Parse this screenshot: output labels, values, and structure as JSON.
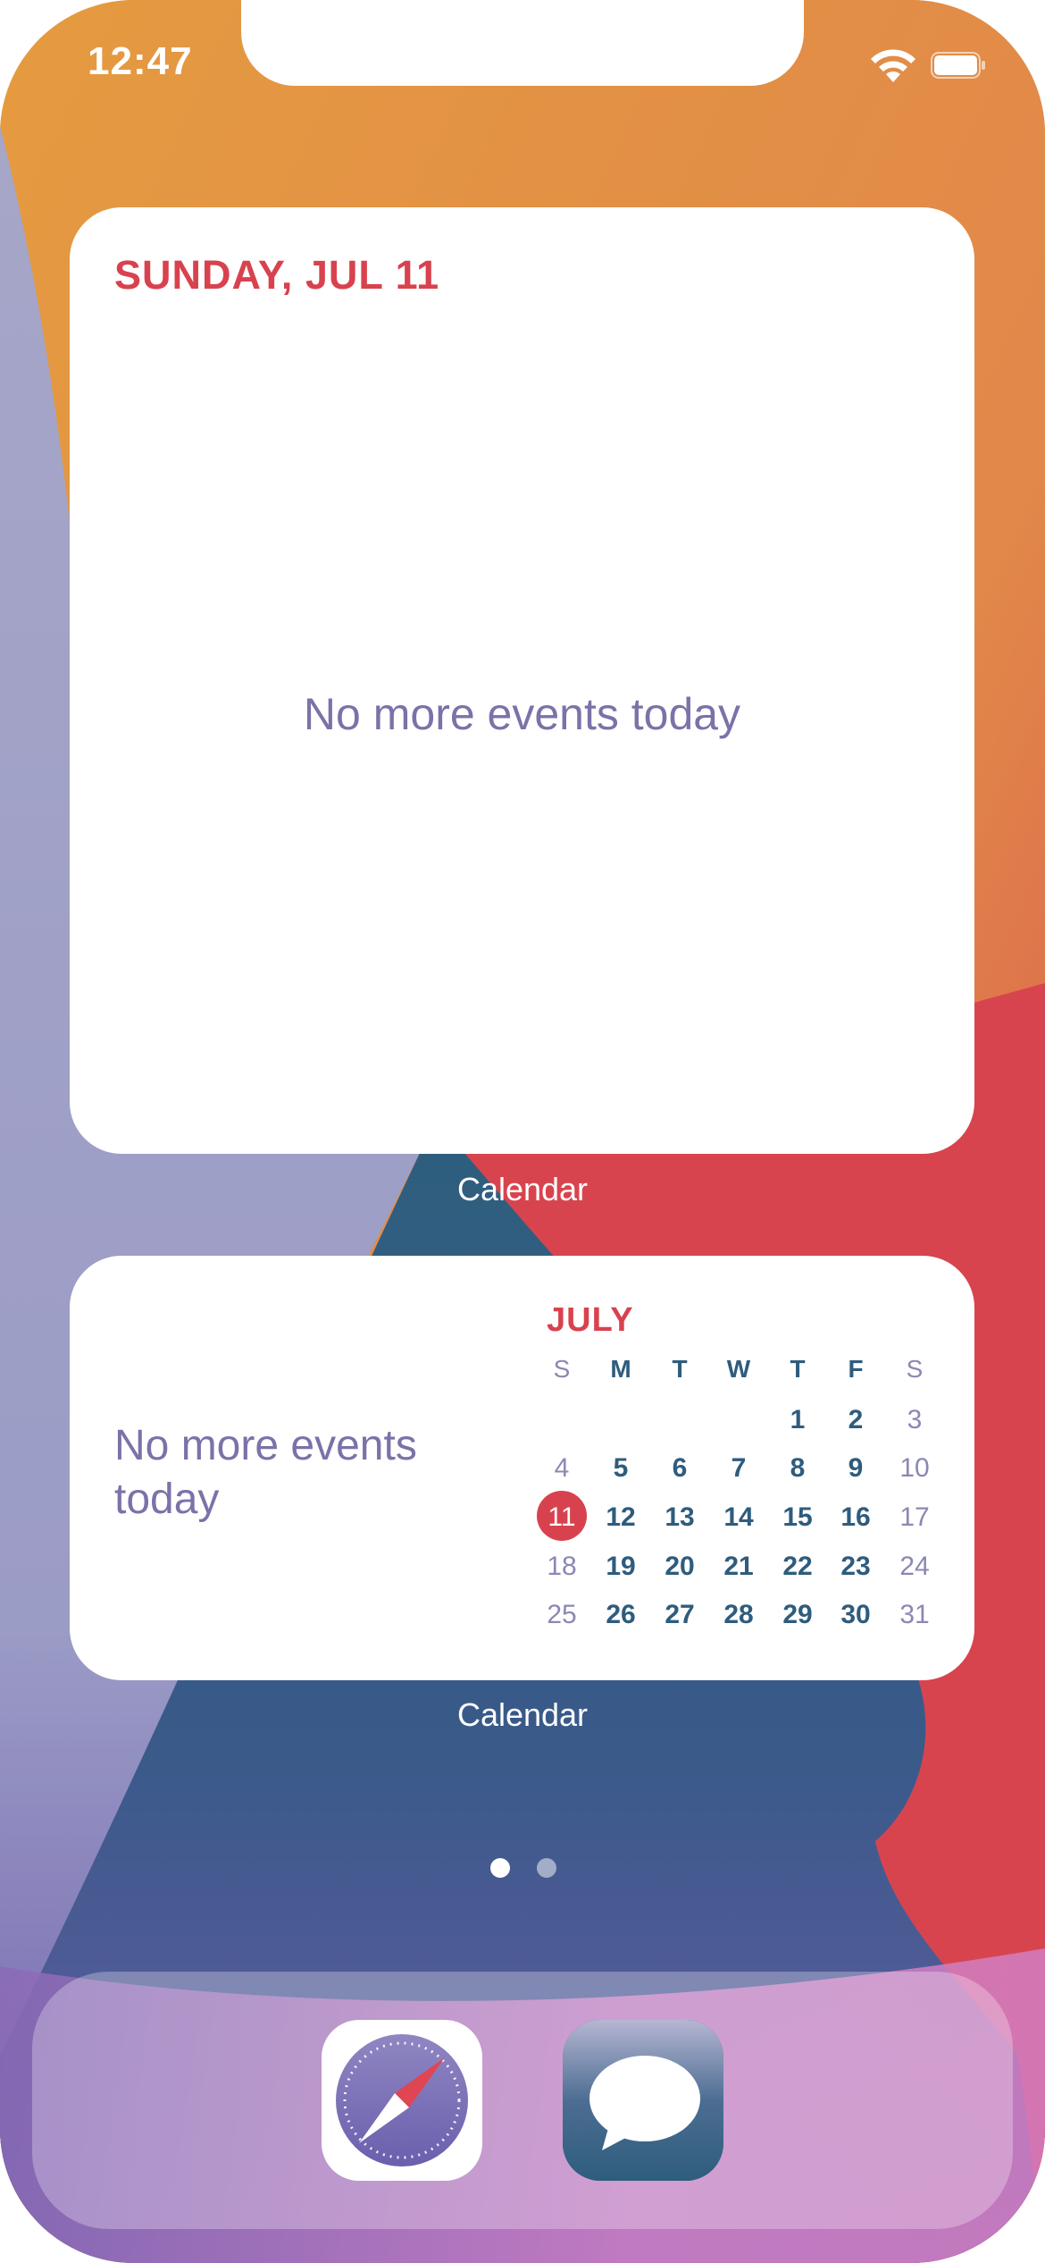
{
  "status_bar": {
    "time": "12:47"
  },
  "widgets": {
    "large": {
      "date": "SUNDAY, JUL 11",
      "message": "No more events today",
      "caption": "Calendar"
    },
    "medium": {
      "message": "No more events today",
      "caption": "Calendar",
      "month": "JULY",
      "weekdays": [
        "S",
        "M",
        "T",
        "W",
        "T",
        "F",
        "S"
      ],
      "weeks": [
        [
          "",
          "",
          "",
          "",
          "1",
          "2",
          "3"
        ],
        [
          "4",
          "5",
          "6",
          "7",
          "8",
          "9",
          "10"
        ],
        [
          "11",
          "12",
          "13",
          "14",
          "15",
          "16",
          "17"
        ],
        [
          "18",
          "19",
          "20",
          "21",
          "22",
          "23",
          "24"
        ],
        [
          "25",
          "26",
          "27",
          "28",
          "29",
          "30",
          "31"
        ]
      ],
      "today": "11"
    }
  },
  "page_indicator": {
    "total": 2,
    "current": 1
  },
  "dock": {
    "apps": [
      "safari-icon",
      "messages-icon"
    ]
  },
  "colors": {
    "accent_red": "#d8424e",
    "date_blue": "#2e5c7d",
    "muted_purple": "#7a72a8"
  }
}
